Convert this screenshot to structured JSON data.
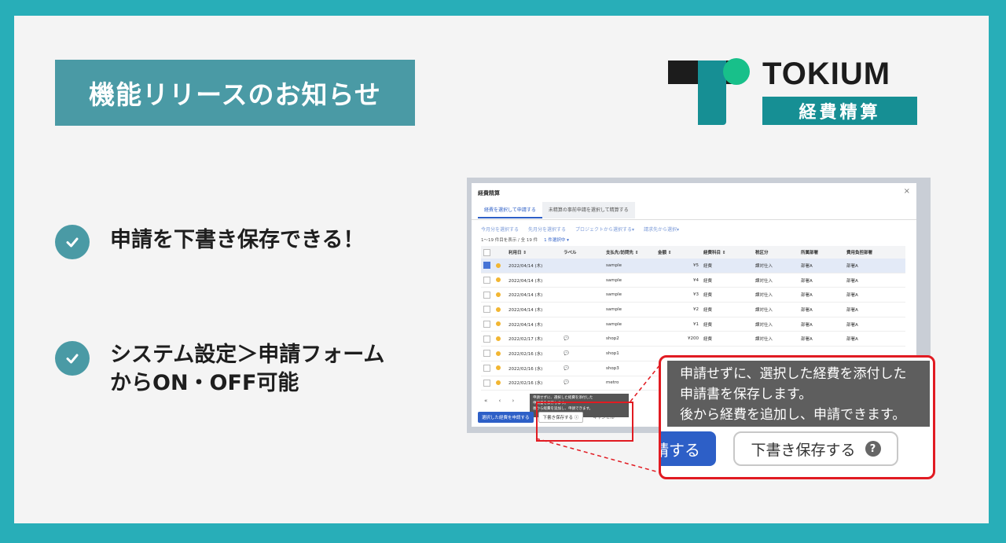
{
  "banner": {
    "title": "機能リリースのお知らせ",
    "logo_word": "TOKIUM",
    "logo_sub": "経費精算"
  },
  "features": [
    {
      "line1": "申請を下書き保存できる！",
      "line2": ""
    },
    {
      "line1": "システム設定＞申請フォーム",
      "line2": "からON・OFF可能"
    }
  ],
  "modal": {
    "title": "経費精算",
    "close": "×",
    "tabs": [
      "経費を選択して申請する",
      "未精算の事前申請を選択して精算する"
    ],
    "filters": [
      "今月分を選択する",
      "先月分を選択する",
      "プロジェクトから選択する▾",
      "請求先から選択▾"
    ],
    "count_text": "1〜19 件目を表示 / 全 19 件",
    "selected_text": "1 件選択中 ▾",
    "columns": [
      "",
      "",
      "利用日 ⇕",
      "ラベル",
      "支払先/訪問先 ⇕",
      "金額 ⇕",
      "経費科目 ⇕",
      "税区分",
      "所属部署",
      "費用負担部署"
    ],
    "rows": [
      {
        "date": "2022/04/14 (木)",
        "label": "",
        "payee": "sample",
        "amount": "¥5",
        "item": "経費",
        "tax": "課対仕入",
        "dept": "部署A",
        "cost": "部署A"
      },
      {
        "date": "2022/04/14 (木)",
        "label": "",
        "payee": "sample",
        "amount": "¥4",
        "item": "経費",
        "tax": "課対仕入",
        "dept": "部署A",
        "cost": "部署A"
      },
      {
        "date": "2022/04/14 (木)",
        "label": "",
        "payee": "sample",
        "amount": "¥3",
        "item": "経費",
        "tax": "課対仕入",
        "dept": "部署A",
        "cost": "部署A"
      },
      {
        "date": "2022/04/14 (木)",
        "label": "",
        "payee": "sample",
        "amount": "¥2",
        "item": "経費",
        "tax": "課対仕入",
        "dept": "部署A",
        "cost": "部署A"
      },
      {
        "date": "2022/04/14 (木)",
        "label": "",
        "payee": "sample",
        "amount": "¥1",
        "item": "経費",
        "tax": "課対仕入",
        "dept": "部署A",
        "cost": "部署A"
      },
      {
        "date": "2022/02/17 (木)",
        "label": "💬",
        "payee": "shop2",
        "amount": "¥200",
        "item": "経費",
        "tax": "課対仕入",
        "dept": "部署A",
        "cost": "部署A"
      },
      {
        "date": "2022/02/16 (水)",
        "label": "💬",
        "payee": "shop1",
        "amount": "",
        "item": "",
        "tax": "",
        "dept": "",
        "cost": ""
      },
      {
        "date": "2022/02/16 (水)",
        "label": "💬",
        "payee": "shop3",
        "amount": "",
        "item": "",
        "tax": "",
        "dept": "",
        "cost": ""
      },
      {
        "date": "2022/02/16 (水)",
        "label": "💬",
        "payee": "metro",
        "amount": "",
        "item": "",
        "tax": "",
        "dept": "",
        "cost": ""
      }
    ],
    "selected_row_index": 0,
    "pager": "« ‹ ›",
    "tooltip": [
      "申請せずに、選択した経費を添付した",
      "申請書を保存します。",
      "後から経費を追加し、申請できます。"
    ],
    "submit_label": "選択した経費を申請する",
    "draft_label": "下書き保存する ⓘ",
    "cancel_label": "キャンセル"
  },
  "zoom": {
    "tooltip": [
      "申請せずに、選択した経費を添付した",
      "申請書を保存します。",
      "後から経費を追加し、申請できます。"
    ],
    "submit_partial": "請する",
    "draft_label": "下書き保存する",
    "help_glyph": "?"
  },
  "colors": {
    "frame": "#28aeb8",
    "badge": "#4a9aa5",
    "brand_teal": "#168f94",
    "brand_green": "#18c08a",
    "primary_blue": "#2d5fc7",
    "highlight_red": "#e11b22"
  }
}
